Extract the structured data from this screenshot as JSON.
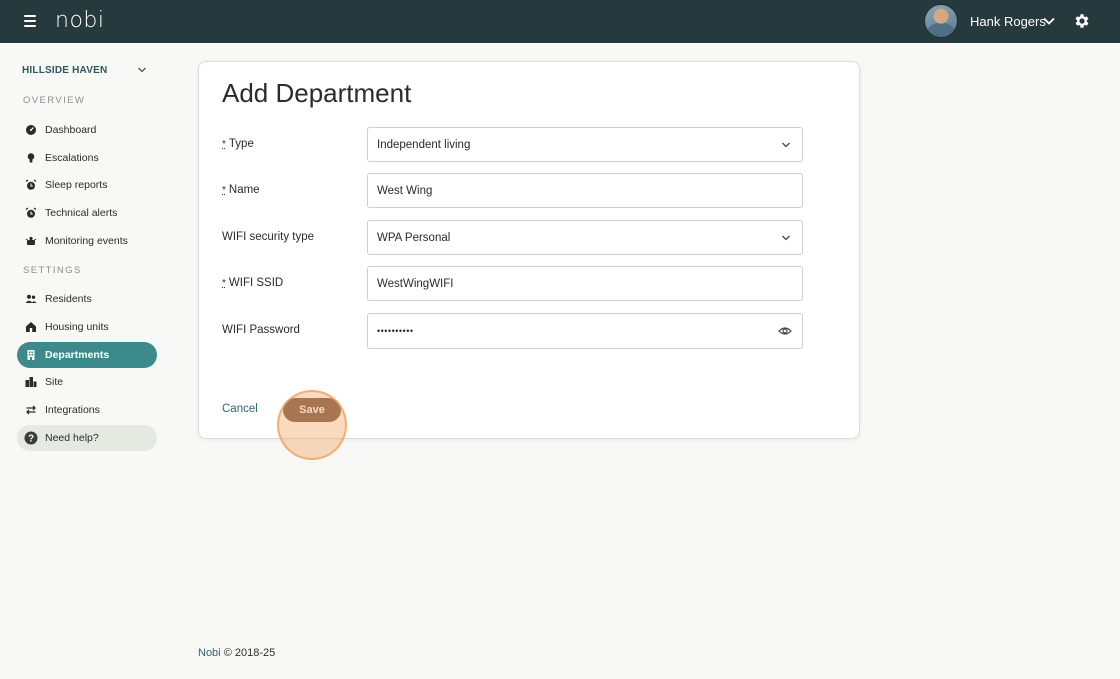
{
  "header": {
    "logo": "nobi",
    "user_name": "Hank Rogers"
  },
  "sidebar": {
    "site_name": "HILLSIDE HAVEN",
    "overview_label": "OVERVIEW",
    "settings_label": "SETTINGS",
    "overview_items": [
      {
        "label": "Dashboard",
        "icon": "dashboard-icon"
      },
      {
        "label": "Escalations",
        "icon": "lightbulb-icon"
      },
      {
        "label": "Sleep reports",
        "icon": "alarm-clock-icon"
      },
      {
        "label": "Technical alerts",
        "icon": "alarm-clock-icon"
      },
      {
        "label": "Monitoring events",
        "icon": "monitoring-icon"
      }
    ],
    "settings_items": [
      {
        "label": "Residents",
        "icon": "people-icon"
      },
      {
        "label": "Housing units",
        "icon": "house-icon"
      },
      {
        "label": "Departments",
        "icon": "building-icon",
        "active": true
      },
      {
        "label": "Site",
        "icon": "city-icon"
      },
      {
        "label": "Integrations",
        "icon": "swap-arrows-icon"
      }
    ],
    "help_label": "Need help?"
  },
  "form": {
    "title": "Add Department",
    "required_mark": "*",
    "fields": {
      "type": {
        "label": "Type",
        "value": "Independent living",
        "required": true
      },
      "name": {
        "label": "Name",
        "value": "West Wing",
        "required": true
      },
      "wifi_security": {
        "label": "WIFI security type",
        "value": "WPA Personal",
        "required": false
      },
      "wifi_ssid": {
        "label": "WIFI SSID",
        "value": "WestWingWIFI",
        "required": true
      },
      "wifi_password": {
        "label": "WIFI Password",
        "value": "••••••••••",
        "required": false
      }
    },
    "cancel_label": "Cancel",
    "save_label": "Save"
  },
  "footer": {
    "brand": "Nobi",
    "copyright": "© 2018-25"
  },
  "colors": {
    "topbar": "#263a3e",
    "accent": "#3d8a8c",
    "save_button": "#6b4a38",
    "help_bg": "#e4e9e1"
  }
}
